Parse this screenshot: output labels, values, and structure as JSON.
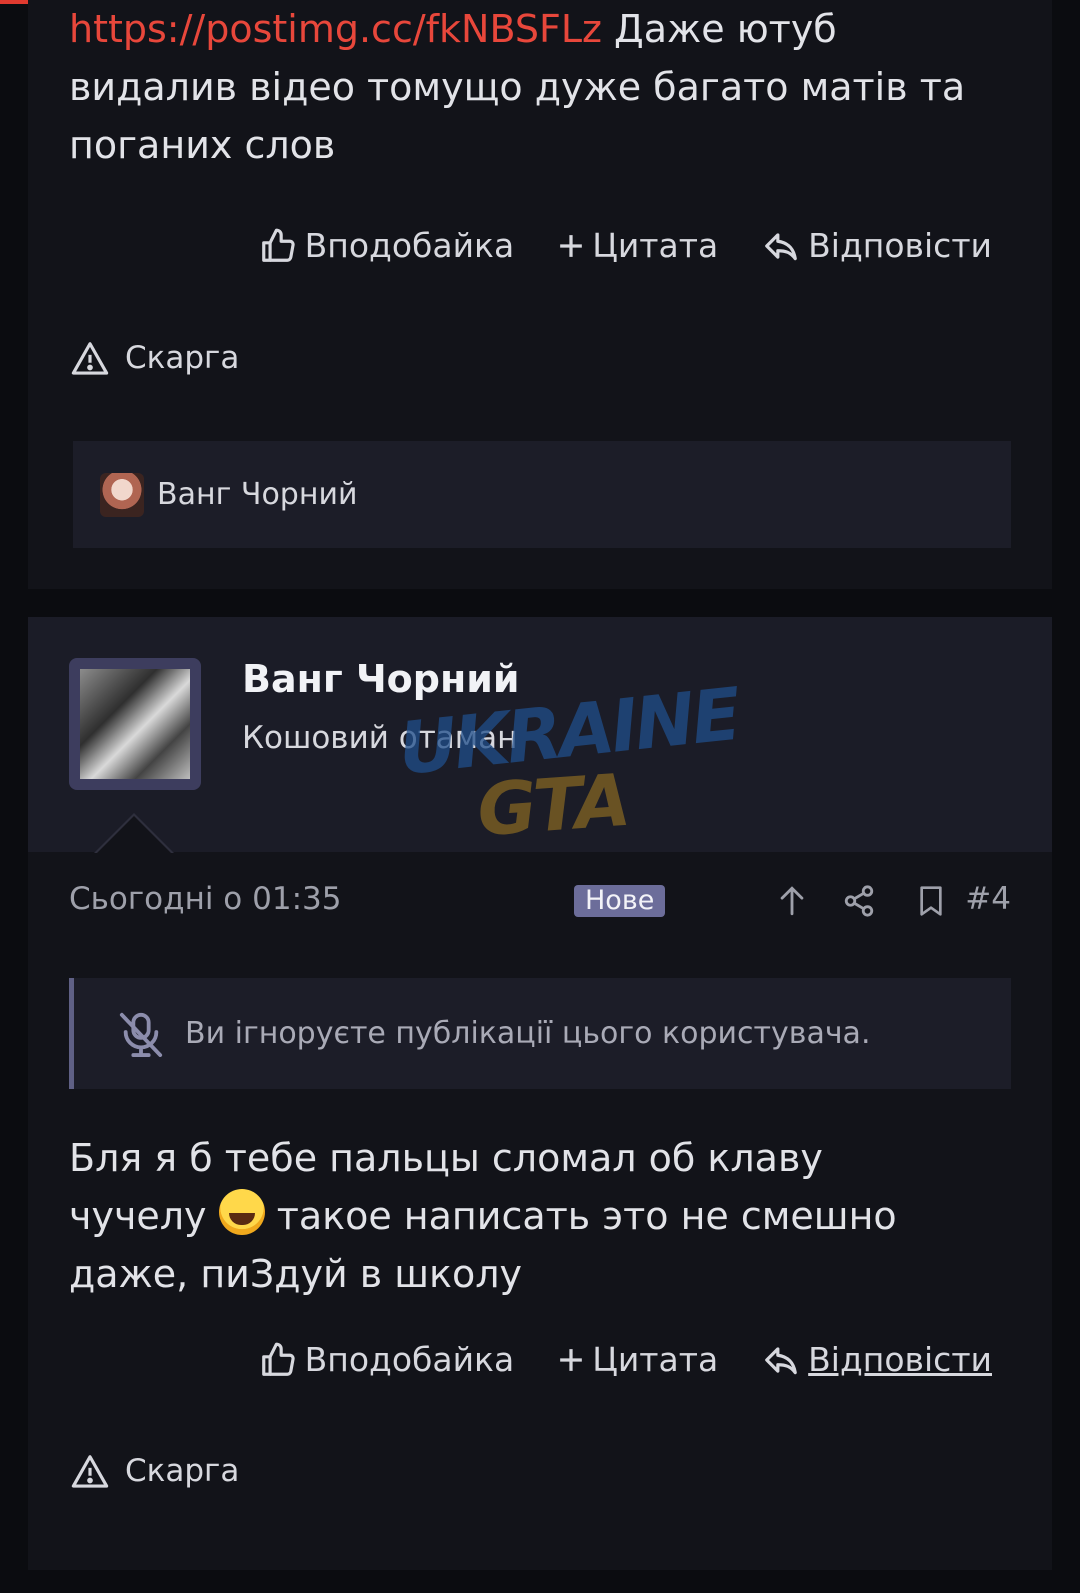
{
  "post1": {
    "link": "https://postimg.cc/fkNBSFLz",
    "text_after_link": " Даже ютуб видалив відео томущо дуже багато матів та поганих слов",
    "actions": {
      "like": "Вподобайка",
      "quote": "Цитата",
      "reply": "Відповісти"
    },
    "report": "Скарга",
    "liked_by": "Ванг Чорний"
  },
  "post2": {
    "author": {
      "name": "Ванг Чорний",
      "title": "Кошовий отаман"
    },
    "watermark": {
      "line1": "UKRAINE",
      "line2": "GTA"
    },
    "date": "Сьогодні о 01:35",
    "badge": "Нове",
    "number": "#4",
    "ignore_notice": "Ви ігноруєте публікації цього користувача.",
    "text_part1": "Бля я б тебе пальцы сломал об клаву чучелу ",
    "text_part2": " такое написать это не смешно даже, пиЗдуй в школу",
    "actions": {
      "like": "Вподобайка",
      "quote": "Цитата",
      "reply": "Відповісти"
    },
    "report": "Скарга"
  },
  "icons": [
    "thumbs-up-icon",
    "plus-icon",
    "reply-icon",
    "warning-icon",
    "arrow-up-icon",
    "share-icon",
    "bookmark-icon",
    "mic-off-icon",
    "laughing-emoji"
  ],
  "colors": {
    "link": "#e8473b",
    "badge": "#6c6d9a",
    "background": "#0b0c10",
    "card": "#121319"
  }
}
